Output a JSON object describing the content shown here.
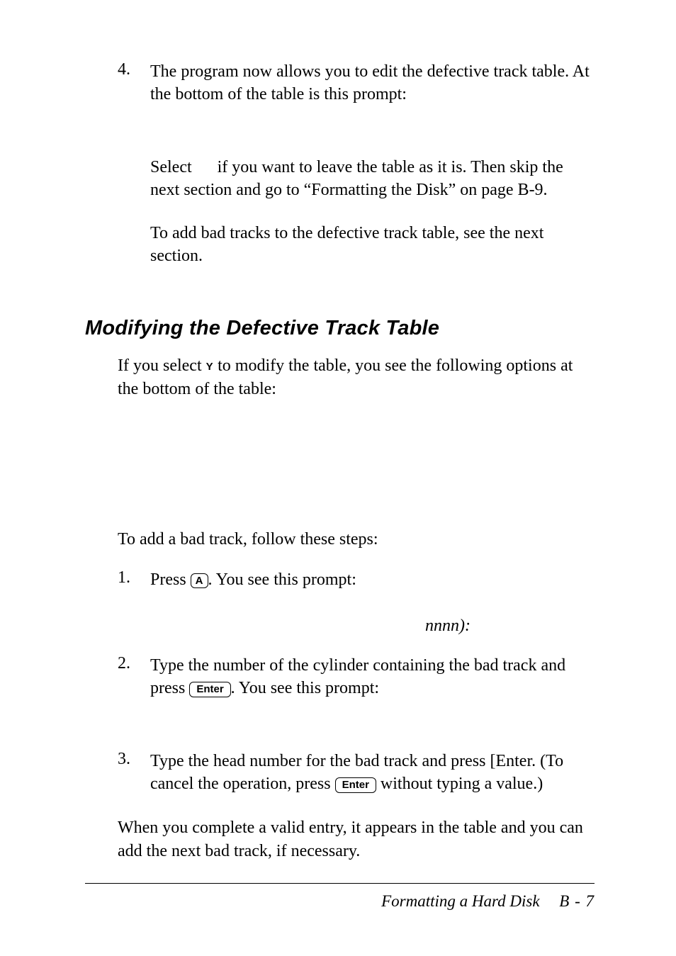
{
  "step4": {
    "num": "4.",
    "text": "The program now allows you to edit the defective track table. At the bottom of the table is this prompt:"
  },
  "step4_followups": {
    "p1_pre": "Select",
    "p1_post": " if you want to leave the table as it is. Then skip the next section and go to “Formatting the Disk” on page B-9.",
    "p2": "To add bad tracks to the defective track table, see the next section."
  },
  "heading": "Modifying the Defective Track Table",
  "intro": {
    "pre": "If you select ",
    "y": "Y",
    "post": " to modify the table, you see the following options at the bottom of the table:"
  },
  "add_bad_intro": "To add a bad track, follow these steps:",
  "sub1": {
    "num": "1.",
    "pre": "Press ",
    "keyA": "A",
    "post": ". You see this prompt:"
  },
  "nnnn_line": "nnnn):",
  "sub2": {
    "num": "2.",
    "line1": "Type the number of the cylinder containing the bad track and press ",
    "keyEnter": "Enter",
    "post": ". You see this prompt:"
  },
  "sub3": {
    "num": "3.",
    "pre": "Type the head number for the bad track and press [Enter. (To cancel the operation, press ",
    "keyEnter": "Enter",
    "post": " without typing a value.)"
  },
  "closing": "When you complete a valid entry, it appears in the table and you can add the next bad track, if necessary.",
  "footer": {
    "title": "Formatting a Hard Disk",
    "page": "B - 7"
  }
}
